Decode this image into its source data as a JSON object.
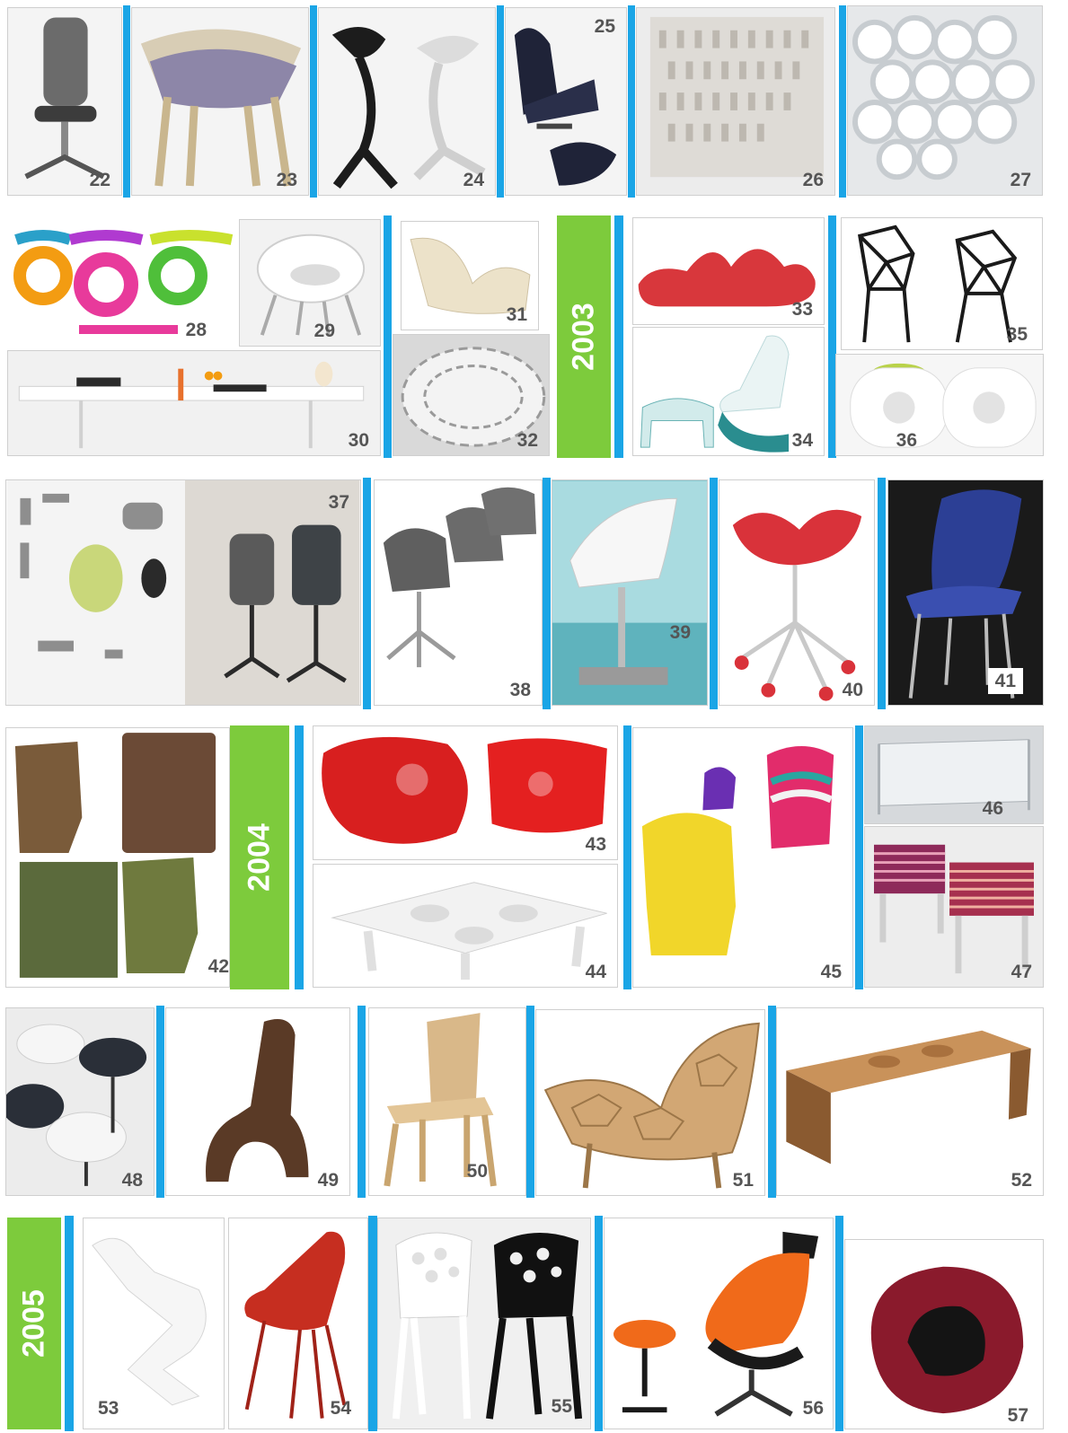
{
  "years": {
    "y2003": "2003",
    "y2004": "2004",
    "y2005": "2005"
  },
  "colors": {
    "separator": "#1aa5e6",
    "year_band": "#7dcb3c",
    "label": "#555555"
  },
  "items": {
    "n22": "22",
    "n23": "23",
    "n24": "24",
    "n25": "25",
    "n26": "26",
    "n27": "27",
    "n28": "28",
    "n29": "29",
    "n30": "30",
    "n31": "31",
    "n32": "32",
    "n33": "33",
    "n34": "34",
    "n35": "35",
    "n36": "36",
    "n37": "37",
    "n38": "38",
    "n39": "39",
    "n40": "40",
    "n41": "41",
    "n42": "42",
    "n43": "43",
    "n44": "44",
    "n45": "45",
    "n46": "46",
    "n47": "47",
    "n48": "48",
    "n49": "49",
    "n50": "50",
    "n51": "51",
    "n52": "52",
    "n53": "53",
    "n54": "54",
    "n55": "55",
    "n56": "56",
    "n57": "57"
  }
}
